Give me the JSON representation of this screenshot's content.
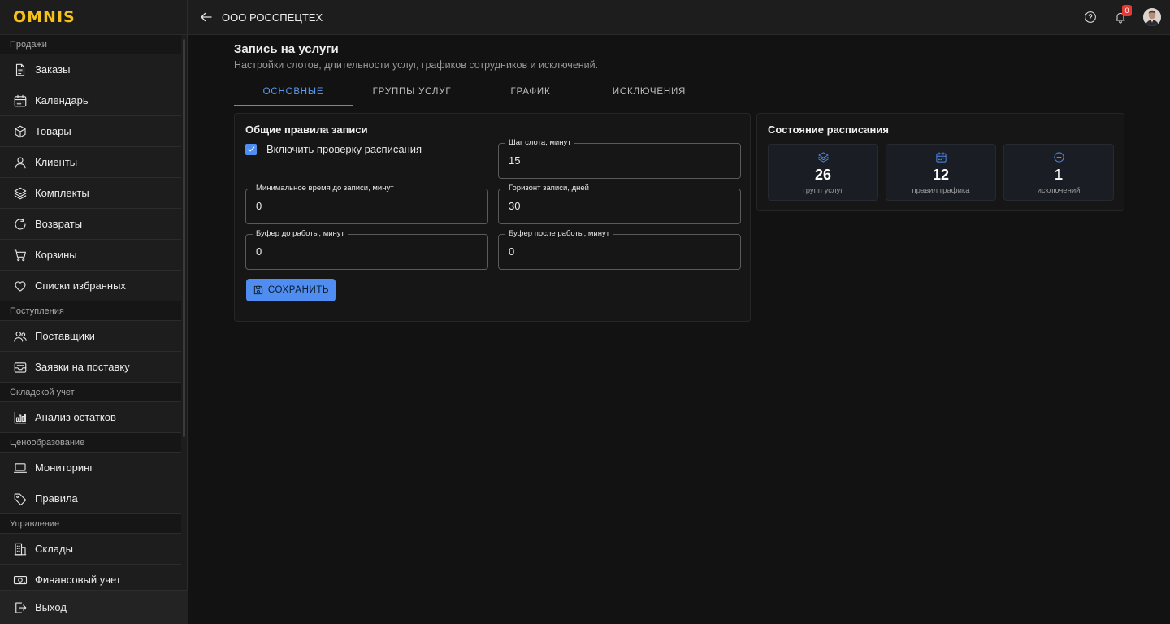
{
  "app": {
    "logo": "OMNIS"
  },
  "header": {
    "company": "ООО РОССПЕЦТЕХ",
    "notifications_count": "0"
  },
  "sidebar": {
    "sections": [
      {
        "title": "Продажи",
        "items": [
          "Заказы",
          "Календарь",
          "Товары",
          "Клиенты",
          "Комплекты",
          "Возвраты",
          "Корзины",
          "Списки избранных"
        ]
      },
      {
        "title": "Поступления",
        "items": [
          "Поставщики",
          "Заявки на поставку"
        ]
      },
      {
        "title": "Складской учет",
        "items": [
          "Анализ остатков"
        ]
      },
      {
        "title": "Ценообразование",
        "items": [
          "Мониторинг",
          "Правила"
        ]
      },
      {
        "title": "Управление",
        "items": [
          "Склады",
          "Финансовый учет"
        ]
      }
    ],
    "logout": "Выход"
  },
  "page": {
    "title": "Запись на услуги",
    "subtitle": "Настройки слотов, длительности услуг, графиков сотрудников и исключений."
  },
  "tabs": [
    "ОСНОВНЫЕ",
    "ГРУППЫ УСЛУГ",
    "ГРАФИК",
    "ИСКЛЮЧЕНИЯ"
  ],
  "rules": {
    "title": "Общие правила записи",
    "checkbox_label": "Включить проверку расписания",
    "checkbox_checked": true,
    "fields": {
      "slot_step": {
        "label": "Шаг слота, минут",
        "value": "15"
      },
      "min_time": {
        "label": "Минимальное время до записи, минут",
        "value": "0"
      },
      "horizon": {
        "label": "Горизонт записи, дней",
        "value": "30"
      },
      "buffer_before": {
        "label": "Буфер до работы, минут",
        "value": "0"
      },
      "buffer_after": {
        "label": "Буфер после работы, минут",
        "value": "0"
      }
    },
    "save_label": "СОХРАНИТЬ"
  },
  "status": {
    "title": "Состояние расписания",
    "stats": [
      {
        "icon": "layers-icon",
        "value": "26",
        "caption": "групп услуг"
      },
      {
        "icon": "calendar-icon",
        "value": "12",
        "caption": "правил графика"
      },
      {
        "icon": "minus-circle-icon",
        "value": "1",
        "caption": "исключений"
      }
    ]
  },
  "colors": {
    "accent": "#4f8ef0",
    "background": "#121212",
    "sidebar": "#1d1d1d",
    "logo": "#f3c21b",
    "badge": "#e53935"
  }
}
